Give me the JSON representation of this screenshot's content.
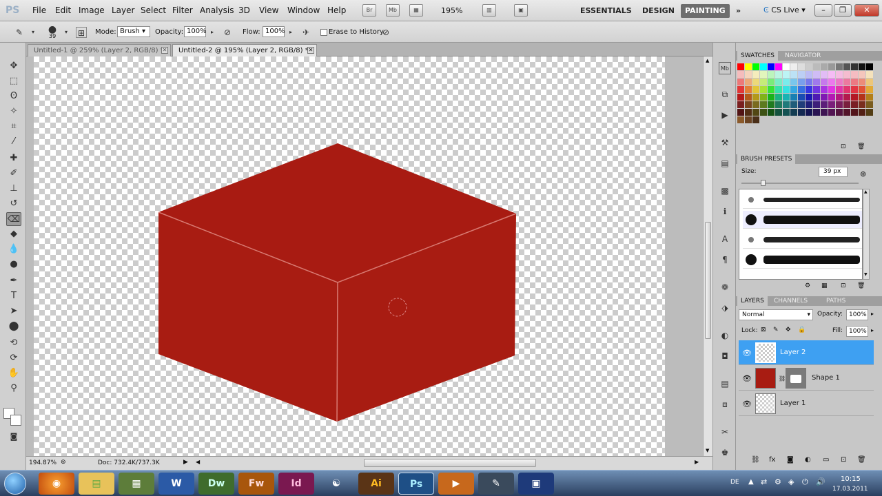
{
  "menu": {
    "logo": "PS",
    "items": [
      "File",
      "Edit",
      "Image",
      "Layer",
      "Select",
      "Filter",
      "Analysis",
      "3D",
      "View",
      "Window",
      "Help"
    ],
    "zoom": "195%",
    "workspaces": [
      "ESSENTIALS",
      "DESIGN",
      "PAINTING"
    ],
    "active_workspace": "PAINTING",
    "cs_live": "CS Live"
  },
  "options": {
    "brush_size": "39",
    "mode_label": "Mode:",
    "mode_value": "Brush",
    "opacity_label": "Opacity:",
    "opacity_value": "100%",
    "flow_label": "Flow:",
    "flow_value": "100%",
    "erase_label": "Erase to History"
  },
  "tabs": [
    {
      "label": "Untitled-1 @ 259% (Layer 2, RGB/8) *",
      "active": false
    },
    {
      "label": "Untitled-2 @ 195% (Layer 2, RGB/8) *",
      "active": true
    }
  ],
  "canvas": {
    "box_top_color": "#a81b12",
    "box_left_color": "#a81c12",
    "box_right_color": "#a81c12",
    "edge_color": "#d87a72"
  },
  "status": {
    "zoom": "194.87%",
    "doc": "Doc: 732.4K/737.3K"
  },
  "swatches_panel": {
    "tabs": [
      "SWATCHES",
      "NAVIGATOR"
    ]
  },
  "brush_presets": {
    "title": "BRUSH PRESETS",
    "size_label": "Size:",
    "size_value": "39 px"
  },
  "layers_panel": {
    "tabs": [
      "LAYERS",
      "CHANNELS",
      "PATHS"
    ],
    "blend_mode": "Normal",
    "opacity_label": "Opacity:",
    "opacity_value": "100%",
    "lock_label": "Lock:",
    "fill_label": "Fill:",
    "fill_value": "100%",
    "layers": [
      {
        "name": "Layer 2",
        "selected": true
      },
      {
        "name": "Shape 1",
        "selected": false
      },
      {
        "name": "Layer 1",
        "selected": false
      }
    ]
  },
  "taskbar": {
    "lang": "DE",
    "time": "10:15",
    "date": "17.03.2011"
  }
}
